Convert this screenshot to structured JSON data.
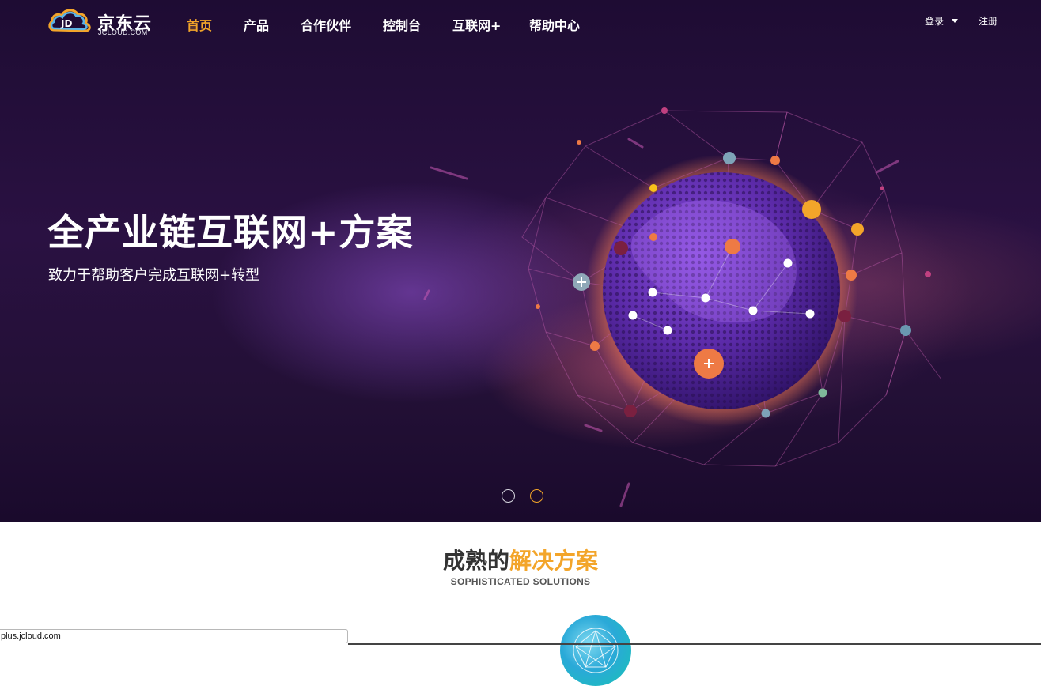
{
  "logo": {
    "badge": "JD",
    "name_cn": "京东云",
    "name_en": "JCLOUD.COM"
  },
  "nav": {
    "items": [
      {
        "label": "首页",
        "active": true
      },
      {
        "label": "产品",
        "active": false
      },
      {
        "label": "合作伙伴",
        "active": false
      },
      {
        "label": "控制台",
        "active": false
      },
      {
        "label": "互联网+",
        "active": false
      },
      {
        "label": "帮助中心",
        "active": false
      }
    ],
    "login": "登录",
    "register": "注册"
  },
  "hero": {
    "title": "全产业链互联网+方案",
    "subtitle": "致力于帮助客户完成互联网+转型",
    "carousel": {
      "slides": 2,
      "active_index": 1
    }
  },
  "section": {
    "title_part1": "成熟的",
    "title_part2": "解决方案",
    "subtitle": "SOPHISTICATED SOLUTIONS"
  },
  "status_bar": {
    "url": "plus.jcloud.com"
  },
  "colors": {
    "accent": "#f3a52a",
    "hero_bg": "#231036",
    "globe": "#5b2aa8",
    "node_orange": "#ee7a45"
  },
  "icons": [
    "cloud-logo-icon",
    "caret-down-icon",
    "plus-icon",
    "globe-illustration"
  ]
}
